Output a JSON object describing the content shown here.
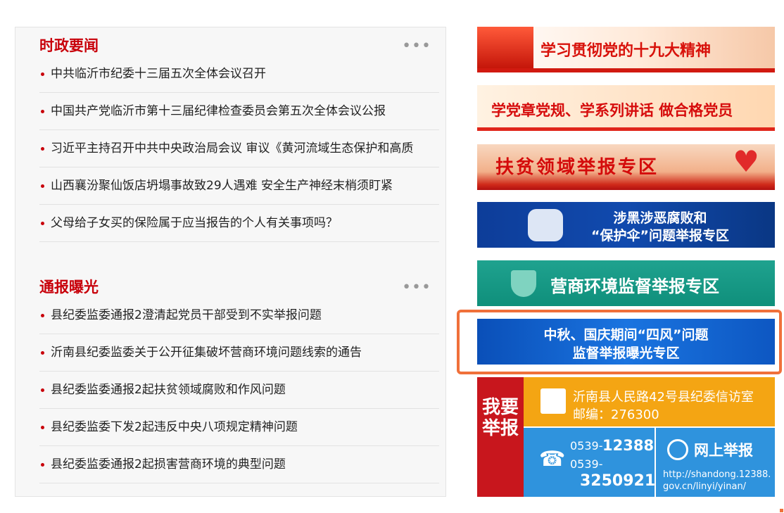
{
  "section1": {
    "title": "时政要闻",
    "more": "•••",
    "items": [
      "中共临沂市纪委十三届五次全体会议召开",
      "中国共产党临沂市第十三届纪律检查委员会第五次全体会议公报",
      "习近平主持召开中共中央政治局会议 审议《黄河流域生态保护和高质",
      "山西襄汾聚仙饭店坍塌事故致29人遇难 安全生产神经末梢须盯紧",
      "父母给子女买的保险属于应当报告的个人有关事项吗？"
    ]
  },
  "section2": {
    "title": "通报曝光",
    "more": "•••",
    "items": [
      "县纪委监委通报2澄清起党员干部受到不实举报问题",
      "沂南县纪委监委关于公开征集破坏营商环境问题线索的通告",
      "县纪委监委通报2起扶贫领域腐败和作风问题",
      "县纪委监委下发2起违反中央八项规定精神问题",
      "县纪委监委通报2起损害营商环境的典型问题"
    ]
  },
  "banners": {
    "b1": "学习贯彻党的十九大精神",
    "b2": "学党章党规、学系列讲话 做合格党员",
    "b3": "扶贫领域举报专区",
    "b4_line1": "涉黑涉恶腐败和",
    "b4_line2": "“保护伞”问题举报专区",
    "b5": "营商环境监督举报专区",
    "b6_line1": "中秋、国庆期间“四风”问题",
    "b6_line2": "监督举报曝光专区"
  },
  "report": {
    "vertical": "我要举报",
    "address": "沂南县人民路42号县纪委信访室",
    "postcode": "邮编：276300",
    "phone_prefix1": "0539-",
    "phone_num1": "12388",
    "phone_prefix2": "0539-",
    "phone_num2": "3250921",
    "online_title": "网上举报",
    "online_url": "http://shandong.12388.gov.cn/linyi/yinan/"
  },
  "colors": {
    "accent_red": "#c8000a",
    "highlight_border": "#f0703a",
    "report_orange": "#f4a513",
    "report_blue": "#2f93dd"
  }
}
